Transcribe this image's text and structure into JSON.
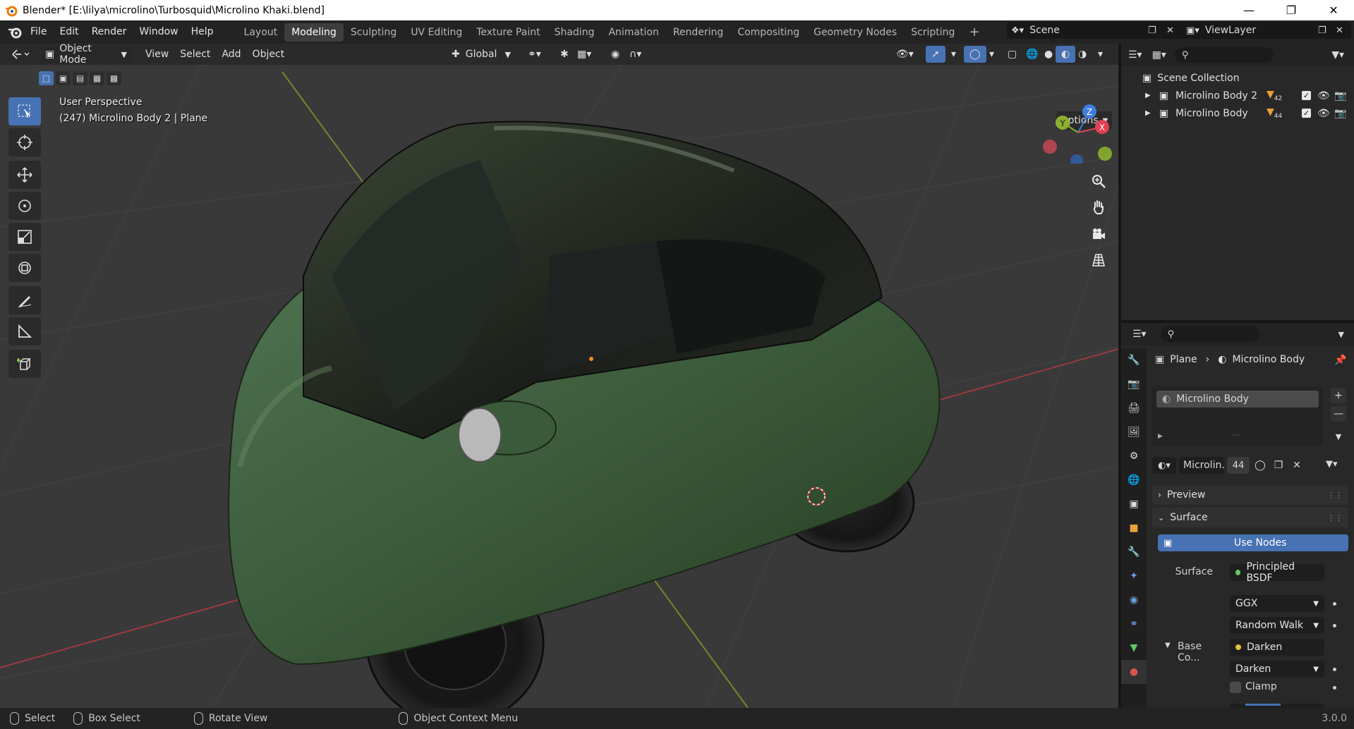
{
  "window": {
    "title": "Blender* [E:\\lilya\\microlino\\Turbosquid\\Microlino Khaki.blend]",
    "controls": [
      "minimize-icon",
      "restore-icon",
      "close-icon"
    ]
  },
  "menubar": {
    "menus": [
      "File",
      "Edit",
      "Render",
      "Window",
      "Help"
    ],
    "workspaces": [
      "Layout",
      "Modeling",
      "Sculpting",
      "UV Editing",
      "Texture Paint",
      "Shading",
      "Animation",
      "Rendering",
      "Compositing",
      "Geometry Nodes",
      "Scripting"
    ],
    "active_workspace": "Modeling",
    "scene": "Scene",
    "view_layer": "ViewLayer"
  },
  "viewport": {
    "mode": "Object Mode",
    "menus": [
      "View",
      "Select",
      "Add",
      "Object"
    ],
    "transform_orientation": "Global",
    "options_label": "Options",
    "overlay_line1": "User Perspective",
    "overlay_line2": "(247) Microlino Body 2 | Plane",
    "gizmo_axes": {
      "x": "X",
      "y": "Y",
      "z": "Z"
    },
    "colors": {
      "accent": "#4772b3",
      "x_axis": "#e04050",
      "y_axis": "#8bb02f",
      "z_axis": "#3d7dde",
      "car_body": "#3b5a3a"
    },
    "tools": [
      "select-box-icon",
      "cursor-icon",
      "move-icon",
      "rotate-icon",
      "scale-icon",
      "transform-icon",
      "annotate-icon",
      "measure-icon",
      "add-cube-icon"
    ],
    "nav": [
      "zoom-icon",
      "pan-hand-icon",
      "camera-icon",
      "grid-ortho-icon"
    ]
  },
  "outliner": {
    "root": "Scene Collection",
    "items": [
      {
        "name": "Microlino Body 2",
        "badge": "42"
      },
      {
        "name": "Microlino Body",
        "badge": "44"
      }
    ]
  },
  "properties": {
    "breadcrumb_object": "Plane",
    "breadcrumb_material": "Microlino Body",
    "slot": "Microlino Body",
    "material_name": "Microlin...",
    "material_users": "44",
    "panels": {
      "preview": "Preview",
      "surface": "Surface"
    },
    "use_nodes": "Use Nodes",
    "surface_label": "Surface",
    "surface_value": "Principled BSDF",
    "distribution": "GGX",
    "subsurface": "Random Walk",
    "base_color_label": "Base Co...",
    "base_color_value": "Darken",
    "blend_mode": "Darken",
    "clamp_label": "Clamp"
  },
  "statusbar": {
    "select": "Select",
    "box_select": "Box Select",
    "rotate_view": "Rotate View",
    "context_menu": "Object Context Menu",
    "version": "3.0.0"
  }
}
